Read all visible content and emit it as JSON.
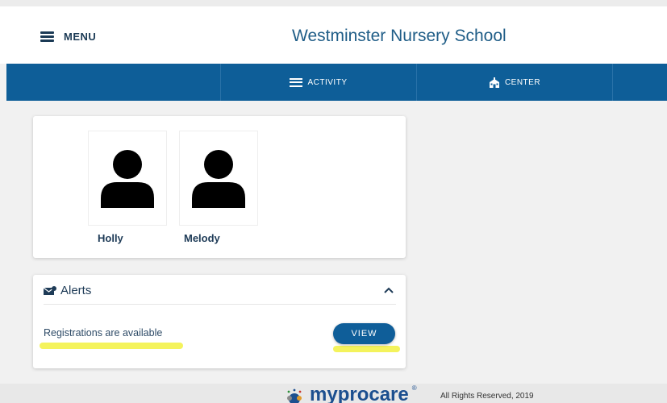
{
  "header": {
    "menu_label": "MENU",
    "school_name": "Westminster Nursery School"
  },
  "nav": {
    "tabs": [
      {
        "label": "ACTIVITY",
        "icon": "list-icon"
      },
      {
        "label": "CENTER",
        "icon": "building-icon"
      }
    ]
  },
  "children": [
    {
      "name": "Holly"
    },
    {
      "name": "Melody"
    }
  ],
  "alerts": {
    "title": "Alerts",
    "message": "Registrations are available",
    "view_label": "VIEW"
  },
  "footer": {
    "brand": "myprocare",
    "copyright": "All Rights Reserved, 2019"
  },
  "colors": {
    "primary": "#0e5e98",
    "title": "#1f5d87",
    "highlight": "#f3f24a"
  }
}
